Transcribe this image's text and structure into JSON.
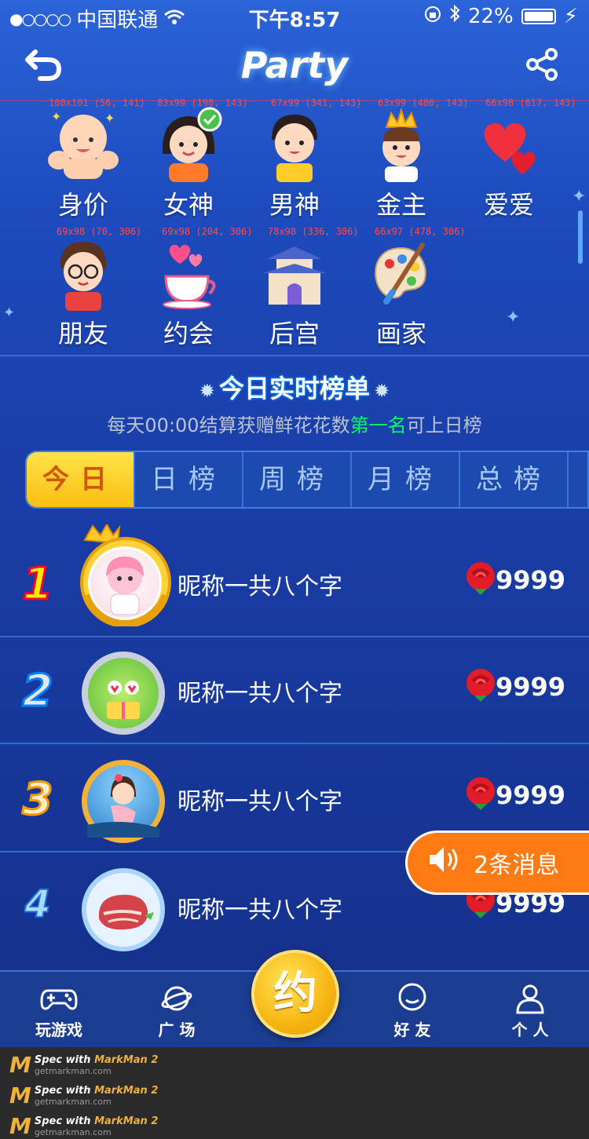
{
  "status": {
    "carrier": "中国联通",
    "time": "下午8:57",
    "battery": "22%",
    "signal_dots": "●○○○○"
  },
  "header": {
    "title": "Party",
    "back_icon": "back-arrow-icon",
    "share_icon": "share-icon"
  },
  "categories": [
    {
      "label": "身价",
      "icon": "muscle-baby-icon",
      "dim": "100x101 (56, 141)"
    },
    {
      "label": "女神",
      "icon": "goddess-girl-icon",
      "dim": "83x99 (198, 143)"
    },
    {
      "label": "男神",
      "icon": "boy-icon",
      "dim": "67x99 (341, 143)"
    },
    {
      "label": "金主",
      "icon": "crown-boy-icon",
      "dim": "63x99 (480, 143)"
    },
    {
      "label": "爱爱",
      "icon": "hearts-icon",
      "dim": "66x98 (617, 143)"
    },
    {
      "label": "朋友",
      "icon": "glasses-boy-icon",
      "dim": "69x98 (70, 306)"
    },
    {
      "label": "约会",
      "icon": "coffee-heart-icon",
      "dim": "69x98 (204, 306)"
    },
    {
      "label": "后宫",
      "icon": "palace-icon",
      "dim": "78x98 (336, 306)"
    },
    {
      "label": "画家",
      "icon": "palette-icon",
      "dim": "66x97 (478, 306)"
    }
  ],
  "ranking": {
    "title": "今日实时榜单",
    "subtitle_pre": "每天00:00结算获赠鲜花花数",
    "subtitle_hl": "第一名",
    "subtitle_post": "可上日榜",
    "tabs": [
      "今日",
      "日榜",
      "周榜",
      "月榜",
      "总榜"
    ],
    "active_tab": 0,
    "rows": [
      {
        "rank": "1",
        "name": "昵称一共八个字",
        "score": "9999",
        "rank_color": "#ffec00",
        "rank_stroke": "#f00033"
      },
      {
        "rank": "2",
        "name": "昵称一共八个字",
        "score": "9999",
        "rank_color": "#e4e6ee",
        "rank_stroke": "#0082ff"
      },
      {
        "rank": "3",
        "name": "昵称一共八个字",
        "score": "9999",
        "rank_color": "#ffeec6",
        "rank_stroke": "#f59700"
      },
      {
        "rank": "4",
        "name": "昵称一共八个字",
        "score": "9999",
        "rank_color": "#a9dcff",
        "rank_stroke": "#1c6fe0"
      }
    ]
  },
  "toast": {
    "text": "2条消息"
  },
  "nav": {
    "items": [
      {
        "label": "玩游戏",
        "icon": "gamepad-icon"
      },
      {
        "label": "广 场",
        "icon": "planet-icon"
      },
      {
        "label": "好 友",
        "icon": "chat-bubble-icon"
      },
      {
        "label": "个 人",
        "icon": "person-icon"
      }
    ],
    "center": "约"
  },
  "footer": {
    "spec": "Spec with",
    "brand": "MarkMan 2",
    "site": "getmarkman.com"
  },
  "colors": {
    "accent": "#ff7a13",
    "tab_active": "#fbbf10",
    "bg": "#1d4bbd",
    "green_highlight": "#00ff5d",
    "subtitle": "#bcc2d4"
  }
}
